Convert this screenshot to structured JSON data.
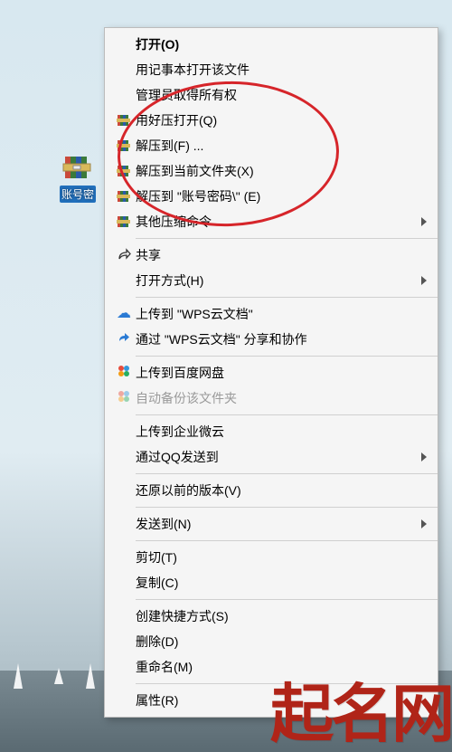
{
  "desktop_icon": {
    "label": "账号密"
  },
  "menu": {
    "open": "打开(O)",
    "open_notepad": "用记事本打开该文件",
    "admin_owner": "管理员取得所有权",
    "haozip_open": "用好压打开(Q)",
    "extract_to": "解压到(F) ...",
    "extract_here": "解压到当前文件夹(X)",
    "extract_named": "解压到 \"账号密码\\\" (E)",
    "other_archive": "其他压缩命令",
    "share": "共享",
    "open_with": "打开方式(H)",
    "upload_wps": "上传到 \"WPS云文档\"",
    "share_wps": "通过 \"WPS云文档\" 分享和协作",
    "upload_baidu": "上传到百度网盘",
    "auto_backup": "自动备份该文件夹",
    "upload_qiye": "上传到企业微云",
    "send_qq": "通过QQ发送到",
    "restore_versions": "还原以前的版本(V)",
    "send_to": "发送到(N)",
    "cut": "剪切(T)",
    "copy": "复制(C)",
    "shortcut": "创建快捷方式(S)",
    "delete": "删除(D)",
    "rename": "重命名(M)",
    "properties": "属性(R)"
  },
  "watermark": "起名网"
}
